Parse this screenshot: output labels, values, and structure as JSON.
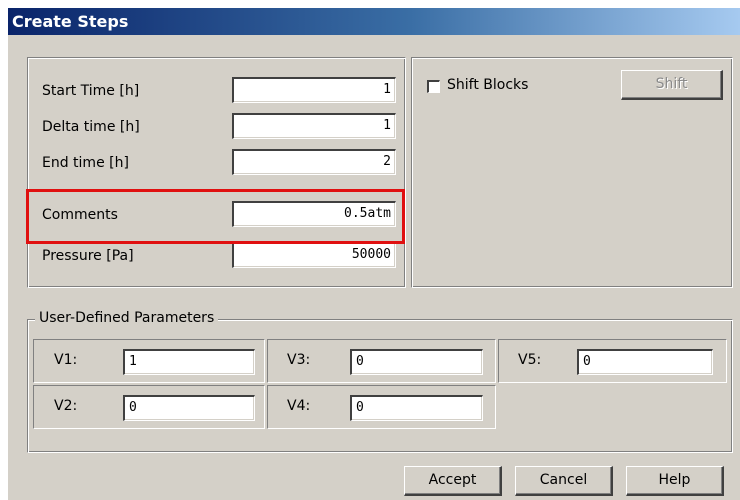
{
  "window": {
    "title": "Create Steps"
  },
  "time_panel": {
    "rows": [
      {
        "label": "Start Time [h]",
        "value": "1"
      },
      {
        "label": "Delta time [h]",
        "value": "1"
      },
      {
        "label": "End time [h]",
        "value": "2"
      },
      {
        "label": "Comments",
        "value": "0.5atm"
      },
      {
        "label": "Pressure [Pa]",
        "value": "50000"
      }
    ]
  },
  "shift_panel": {
    "checkbox_label": "Shift Blocks",
    "checked": false,
    "button_label": "Shift"
  },
  "params": {
    "legend": "User-Defined Parameters",
    "items": [
      {
        "label": "V1:",
        "value": "1"
      },
      {
        "label": "V3:",
        "value": "0"
      },
      {
        "label": "V5:",
        "value": "0"
      },
      {
        "label": "V2:",
        "value": "0"
      },
      {
        "label": "V4:",
        "value": "0"
      }
    ]
  },
  "buttons": {
    "accept": "Accept",
    "cancel": "Cancel",
    "help": "Help"
  },
  "highlight_color": "#e01010"
}
